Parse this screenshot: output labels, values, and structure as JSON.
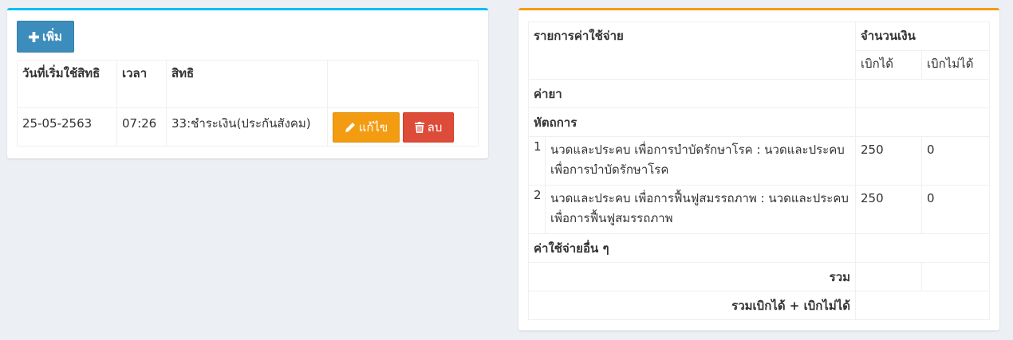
{
  "left_panel": {
    "add_button_label": "เพิ่ม",
    "columns": [
      "วันที่เริ่มใช้สิทธิ",
      "เวลา",
      "สิทธิ"
    ],
    "rows": [
      {
        "date": "25-05-2563",
        "time": "07:26",
        "right": "33:ชำระเงิน(ประกันสังคม)",
        "edit_label": "แก้ไข",
        "delete_label": "ลบ"
      }
    ]
  },
  "right_panel": {
    "header": {
      "item": "รายการค่าใช้จ่าย",
      "amount": "จำนวนเงิน",
      "claimable": "เบิกได้",
      "non_claimable": "เบิกไม่ได้"
    },
    "sections": {
      "medicine": "ค่ายา",
      "procedures": "หัตถการ",
      "other": "ค่าใช้จ่ายอื่น ๆ"
    },
    "procedures": [
      {
        "no": "1",
        "name": "นวดและประคบ เพื่อการบำบัดรักษาโรค : นวดและประคบ เพื่อการบำบัดรักษาโรค",
        "claimable": "250",
        "non_claimable": "0"
      },
      {
        "no": "2",
        "name": "นวดและประคบ เพื่อการฟื้นฟูสมรรถภาพ : นวดและประคบ เพื่อการฟื้นฟูสมรรถภาพ",
        "claimable": "250",
        "non_claimable": "0"
      }
    ],
    "total_label": "รวม",
    "grand_total_label": "รวมเบิกได้ + เบิกไม่ได้"
  },
  "colors": {
    "info": "#00c0ef",
    "warning": "#f39c12",
    "primary": "#3c8dbc",
    "danger": "#dd4b39"
  }
}
